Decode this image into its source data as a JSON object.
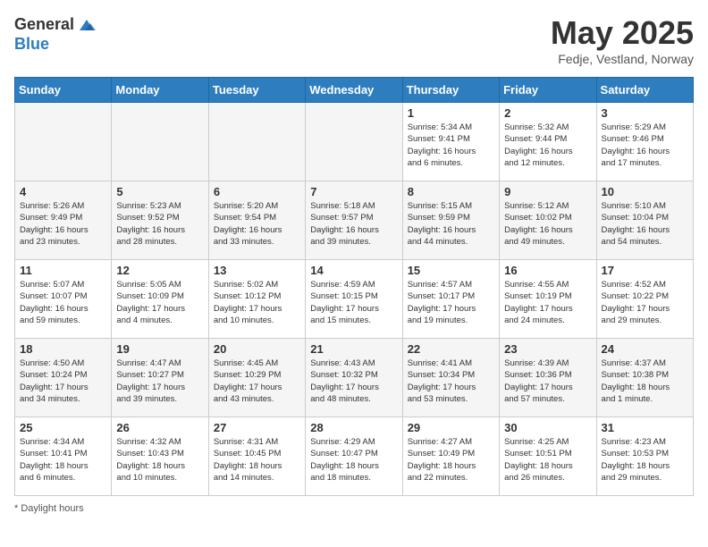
{
  "header": {
    "logo_general": "General",
    "logo_blue": "Blue",
    "month_title": "May 2025",
    "location": "Fedje, Vestland, Norway"
  },
  "days_of_week": [
    "Sunday",
    "Monday",
    "Tuesday",
    "Wednesday",
    "Thursday",
    "Friday",
    "Saturday"
  ],
  "weeks": [
    [
      {
        "day": "",
        "info": ""
      },
      {
        "day": "",
        "info": ""
      },
      {
        "day": "",
        "info": ""
      },
      {
        "day": "",
        "info": ""
      },
      {
        "day": "1",
        "info": "Sunrise: 5:34 AM\nSunset: 9:41 PM\nDaylight: 16 hours\nand 6 minutes."
      },
      {
        "day": "2",
        "info": "Sunrise: 5:32 AM\nSunset: 9:44 PM\nDaylight: 16 hours\nand 12 minutes."
      },
      {
        "day": "3",
        "info": "Sunrise: 5:29 AM\nSunset: 9:46 PM\nDaylight: 16 hours\nand 17 minutes."
      }
    ],
    [
      {
        "day": "4",
        "info": "Sunrise: 5:26 AM\nSunset: 9:49 PM\nDaylight: 16 hours\nand 23 minutes."
      },
      {
        "day": "5",
        "info": "Sunrise: 5:23 AM\nSunset: 9:52 PM\nDaylight: 16 hours\nand 28 minutes."
      },
      {
        "day": "6",
        "info": "Sunrise: 5:20 AM\nSunset: 9:54 PM\nDaylight: 16 hours\nand 33 minutes."
      },
      {
        "day": "7",
        "info": "Sunrise: 5:18 AM\nSunset: 9:57 PM\nDaylight: 16 hours\nand 39 minutes."
      },
      {
        "day": "8",
        "info": "Sunrise: 5:15 AM\nSunset: 9:59 PM\nDaylight: 16 hours\nand 44 minutes."
      },
      {
        "day": "9",
        "info": "Sunrise: 5:12 AM\nSunset: 10:02 PM\nDaylight: 16 hours\nand 49 minutes."
      },
      {
        "day": "10",
        "info": "Sunrise: 5:10 AM\nSunset: 10:04 PM\nDaylight: 16 hours\nand 54 minutes."
      }
    ],
    [
      {
        "day": "11",
        "info": "Sunrise: 5:07 AM\nSunset: 10:07 PM\nDaylight: 16 hours\nand 59 minutes."
      },
      {
        "day": "12",
        "info": "Sunrise: 5:05 AM\nSunset: 10:09 PM\nDaylight: 17 hours\nand 4 minutes."
      },
      {
        "day": "13",
        "info": "Sunrise: 5:02 AM\nSunset: 10:12 PM\nDaylight: 17 hours\nand 10 minutes."
      },
      {
        "day": "14",
        "info": "Sunrise: 4:59 AM\nSunset: 10:15 PM\nDaylight: 17 hours\nand 15 minutes."
      },
      {
        "day": "15",
        "info": "Sunrise: 4:57 AM\nSunset: 10:17 PM\nDaylight: 17 hours\nand 19 minutes."
      },
      {
        "day": "16",
        "info": "Sunrise: 4:55 AM\nSunset: 10:19 PM\nDaylight: 17 hours\nand 24 minutes."
      },
      {
        "day": "17",
        "info": "Sunrise: 4:52 AM\nSunset: 10:22 PM\nDaylight: 17 hours\nand 29 minutes."
      }
    ],
    [
      {
        "day": "18",
        "info": "Sunrise: 4:50 AM\nSunset: 10:24 PM\nDaylight: 17 hours\nand 34 minutes."
      },
      {
        "day": "19",
        "info": "Sunrise: 4:47 AM\nSunset: 10:27 PM\nDaylight: 17 hours\nand 39 minutes."
      },
      {
        "day": "20",
        "info": "Sunrise: 4:45 AM\nSunset: 10:29 PM\nDaylight: 17 hours\nand 43 minutes."
      },
      {
        "day": "21",
        "info": "Sunrise: 4:43 AM\nSunset: 10:32 PM\nDaylight: 17 hours\nand 48 minutes."
      },
      {
        "day": "22",
        "info": "Sunrise: 4:41 AM\nSunset: 10:34 PM\nDaylight: 17 hours\nand 53 minutes."
      },
      {
        "day": "23",
        "info": "Sunrise: 4:39 AM\nSunset: 10:36 PM\nDaylight: 17 hours\nand 57 minutes."
      },
      {
        "day": "24",
        "info": "Sunrise: 4:37 AM\nSunset: 10:38 PM\nDaylight: 18 hours\nand 1 minute."
      }
    ],
    [
      {
        "day": "25",
        "info": "Sunrise: 4:34 AM\nSunset: 10:41 PM\nDaylight: 18 hours\nand 6 minutes."
      },
      {
        "day": "26",
        "info": "Sunrise: 4:32 AM\nSunset: 10:43 PM\nDaylight: 18 hours\nand 10 minutes."
      },
      {
        "day": "27",
        "info": "Sunrise: 4:31 AM\nSunset: 10:45 PM\nDaylight: 18 hours\nand 14 minutes."
      },
      {
        "day": "28",
        "info": "Sunrise: 4:29 AM\nSunset: 10:47 PM\nDaylight: 18 hours\nand 18 minutes."
      },
      {
        "day": "29",
        "info": "Sunrise: 4:27 AM\nSunset: 10:49 PM\nDaylight: 18 hours\nand 22 minutes."
      },
      {
        "day": "30",
        "info": "Sunrise: 4:25 AM\nSunset: 10:51 PM\nDaylight: 18 hours\nand 26 minutes."
      },
      {
        "day": "31",
        "info": "Sunrise: 4:23 AM\nSunset: 10:53 PM\nDaylight: 18 hours\nand 29 minutes."
      }
    ]
  ],
  "footer": {
    "note": "Daylight hours"
  }
}
